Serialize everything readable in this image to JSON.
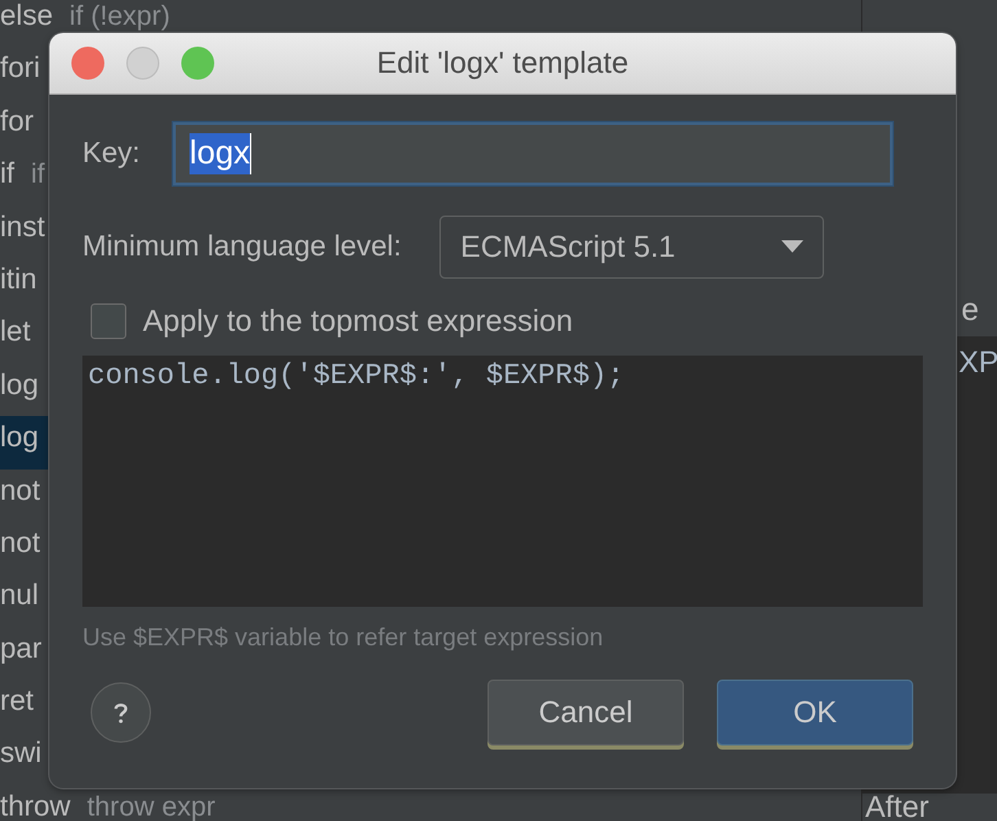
{
  "background": {
    "templates": [
      {
        "key": "else",
        "example": "if (!expr)",
        "selected": false
      },
      {
        "key": "fori",
        "selected": false
      },
      {
        "key": "for",
        "selected": false
      },
      {
        "key": "if",
        "example": "if",
        "selected": false
      },
      {
        "key": "inst",
        "selected": false
      },
      {
        "key": "itin",
        "selected": false
      },
      {
        "key": "let",
        "selected": false
      },
      {
        "key": "log",
        "selected": false
      },
      {
        "key": "log",
        "selected": true
      },
      {
        "key": "not",
        "selected": false
      },
      {
        "key": "not",
        "selected": false
      },
      {
        "key": "nul",
        "selected": false
      },
      {
        "key": "par",
        "selected": false
      },
      {
        "key": "ret",
        "selected": false
      },
      {
        "key": "swi",
        "selected": false
      },
      {
        "key": "throw",
        "example": "throw expr",
        "selected": false
      }
    ],
    "section_label": "e",
    "code_fragment": "XP",
    "after_label": "After"
  },
  "dialog": {
    "title": "Edit 'logx' template",
    "key_label": "Key:",
    "key_value": "logx",
    "language_label": "Minimum language level:",
    "language_value": "ECMAScript 5.1",
    "apply_label": "Apply to the topmost expression",
    "apply_checked": false,
    "template_text": "console.log('$EXPR$:', $EXPR$);",
    "hint": "Use $EXPR$ variable to refer target expression",
    "buttons": [
      {
        "label": "Cancel",
        "kind": "secondary"
      },
      {
        "label": "OK",
        "kind": "primary"
      }
    ]
  }
}
